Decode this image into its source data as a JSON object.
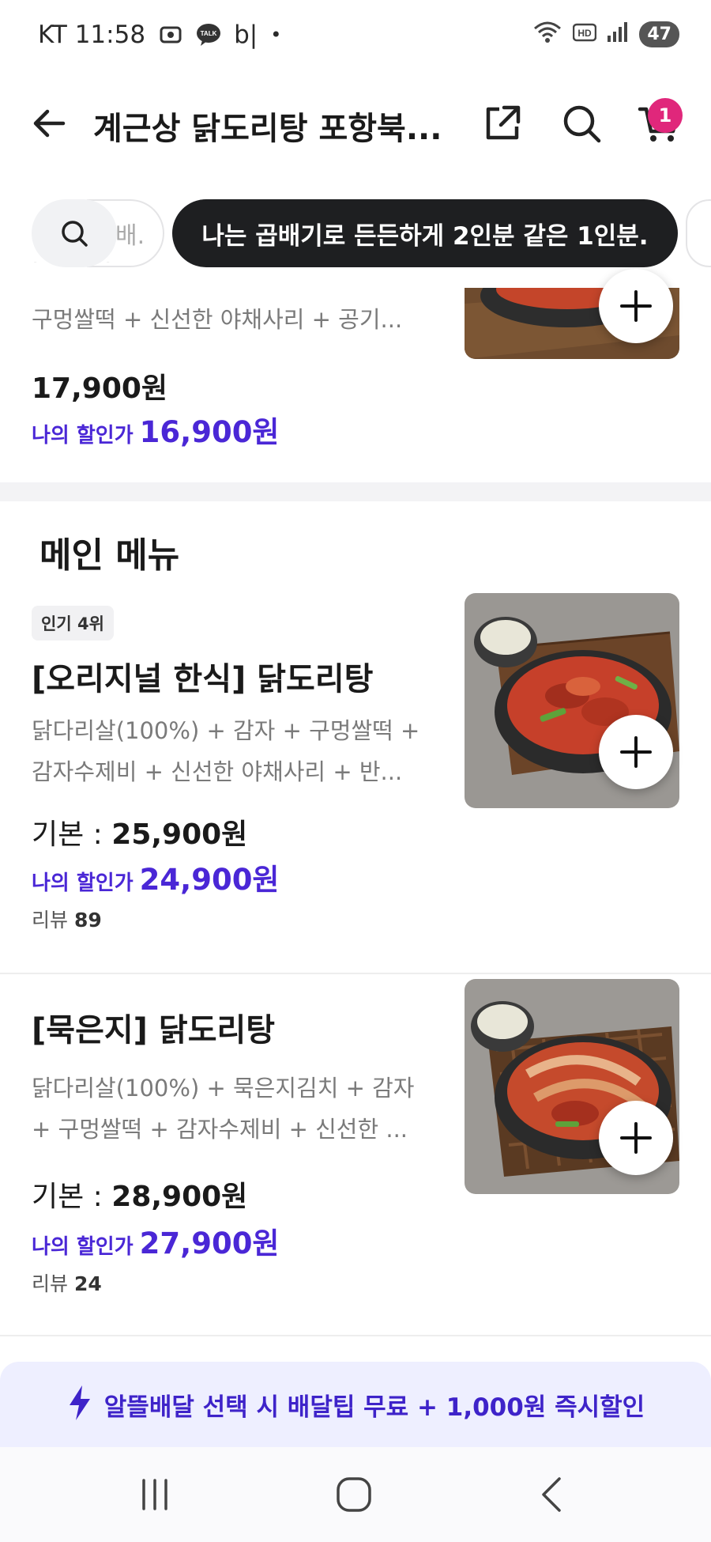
{
  "status": {
    "carrier_time": "KT 11:58",
    "notif_text": "b|",
    "dot": "•",
    "battery": "47"
  },
  "header": {
    "title": "계근상 닭도리탕 포항북...",
    "cart_count": "1"
  },
  "tagbar": {
    "ghost_text": "배.",
    "tooltip": "나는 곱배기로 든든하게 2인분 같은 1인분."
  },
  "prev_item": {
    "desc": "구멍쌀떡 + 신선한 야채사리 + 공기...",
    "price": "17,900원",
    "discount_label": "나의 할인가",
    "discount_price": "16,900원"
  },
  "section": {
    "title": "메인 메뉴"
  },
  "items": [
    {
      "rank": "인기 4위",
      "name": "[오리지널 한식] 닭도리탕",
      "desc_line1": "닭다리살(100%) + 감자 + 구멍쌀떡 +",
      "desc_line2": "감자수제비 + 신선한 야채사리 + 반...",
      "base_label": "기본 : ",
      "base_price": "25,900원",
      "discount_label": "나의 할인가",
      "discount_price": "24,900원",
      "review_label": "리뷰 ",
      "review_count": "89"
    },
    {
      "name": "[묵은지] 닭도리탕",
      "desc_line1": "닭다리살(100%) + 묵은지김치 + 감자",
      "desc_line2": "+ 구멍쌀떡 + 감자수제비 + 신선한 ...",
      "base_label": "기본 : ",
      "base_price": "28,900원",
      "discount_label": "나의 할인가",
      "discount_price": "27,900원",
      "review_label": "리뷰 ",
      "review_count": "24"
    }
  ],
  "promo": {
    "text": "알뜰배달 선택 시 배달팁 무료 + 1,000원 즉시할인"
  },
  "colors": {
    "accent": "#4a27d6",
    "badge": "#e0277b",
    "tooltip_bg": "#1e1f21"
  }
}
